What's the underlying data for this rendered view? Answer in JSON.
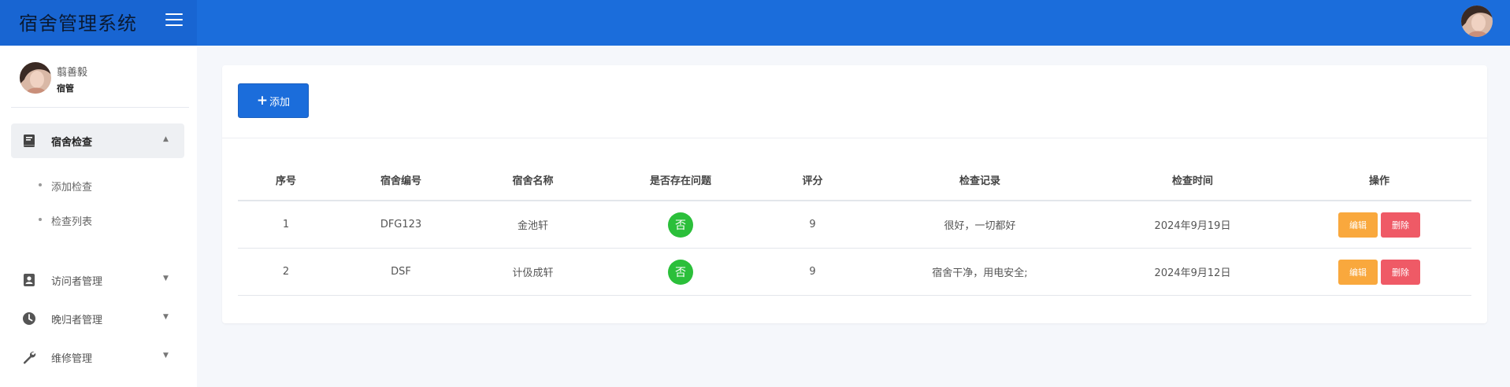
{
  "app": {
    "title": "宿舍管理系统"
  },
  "user": {
    "name": "翦善毅",
    "role": "宿管"
  },
  "sidebar": {
    "active_section": {
      "label": "宿舍检查",
      "icon": "book-icon"
    },
    "sub_items": [
      {
        "label": "添加检查"
      },
      {
        "label": "检查列表"
      }
    ],
    "items": [
      {
        "label": "访问者管理",
        "icon": "contact-card-icon"
      },
      {
        "label": "晚归者管理",
        "icon": "clock-icon"
      },
      {
        "label": "维修管理",
        "icon": "wrench-icon"
      }
    ]
  },
  "toolbar": {
    "add_label": "添加"
  },
  "table": {
    "headers": [
      "序号",
      "宿舍编号",
      "宿舍名称",
      "是否存在问题",
      "评分",
      "检查记录",
      "检查时间",
      "操作"
    ],
    "rows": [
      {
        "index": "1",
        "dorm_no": "DFG123",
        "dorm_name": "金池轩",
        "has_issue": "否",
        "score": "9",
        "record": "很好，一切都好",
        "time": "2024年9月19日"
      },
      {
        "index": "2",
        "dorm_no": "DSF",
        "dorm_name": "计伋成轩",
        "has_issue": "否",
        "score": "9",
        "record": "宿舍干净，用电安全;",
        "time": "2024年9月12日"
      }
    ],
    "actions": {
      "edit": "编辑",
      "delete": "删除"
    }
  },
  "colors": {
    "header_bg": "#1b6ddb",
    "primary": "#1b6ddb",
    "success": "#2bbf3a",
    "warning": "#f9a83d",
    "danger": "#ef5a66"
  }
}
